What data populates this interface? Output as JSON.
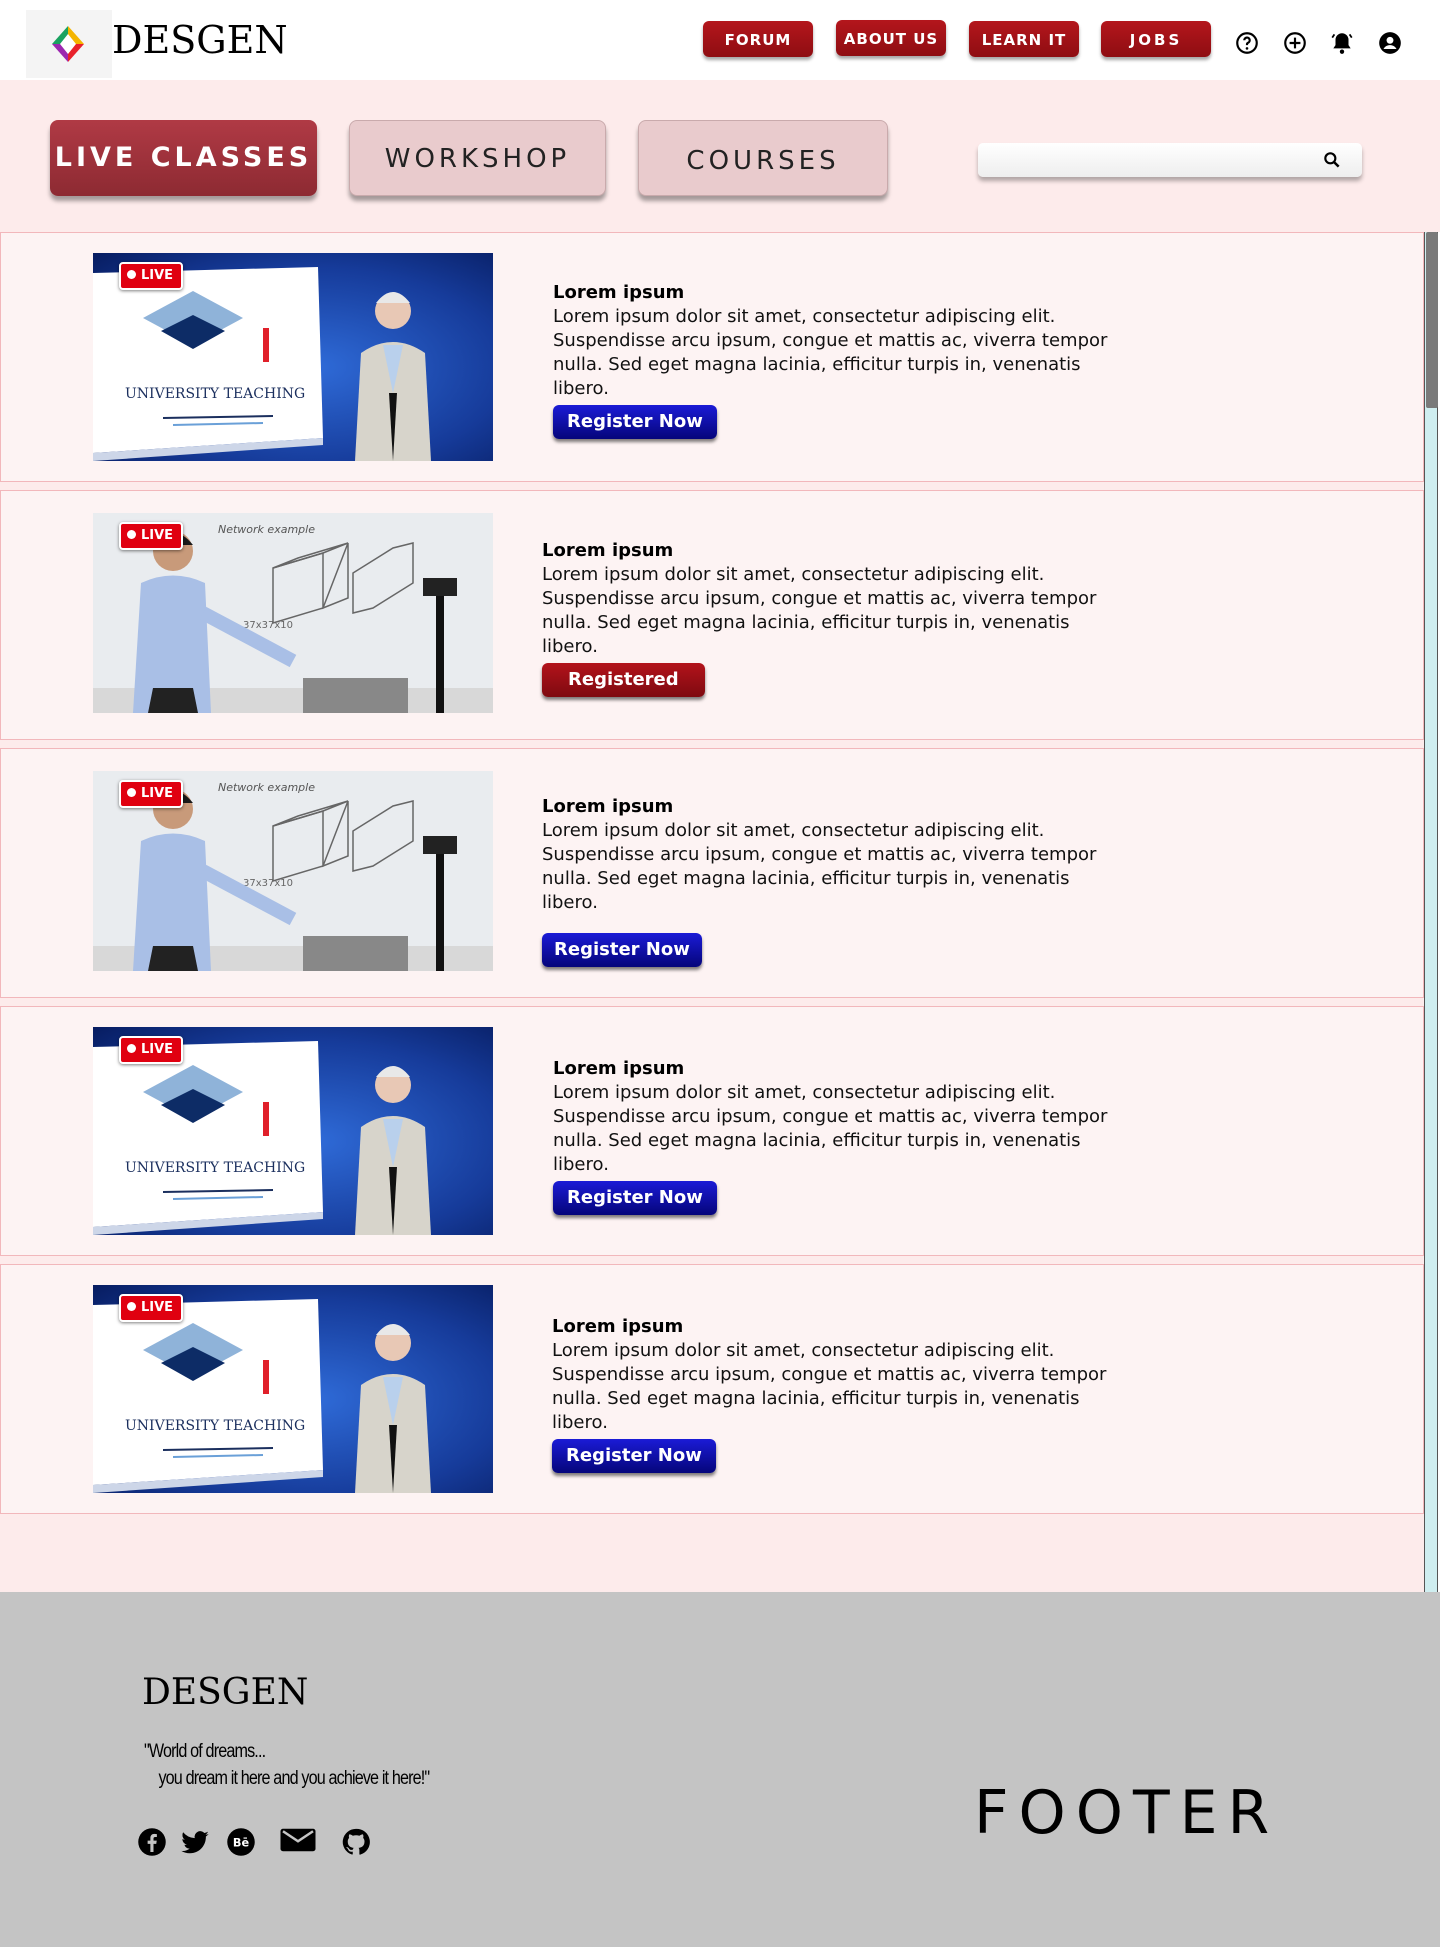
{
  "header": {
    "brand": "DESGEN",
    "nav": [
      {
        "label": "FORUM"
      },
      {
        "label": "ABOUT US"
      },
      {
        "label": "LEARN IT"
      },
      {
        "label": "JOBS"
      }
    ],
    "icons": [
      "help-icon",
      "add-circle-icon",
      "bell-icon",
      "account-icon"
    ]
  },
  "tabs": [
    {
      "label": "LIVE CLASSES",
      "active": true
    },
    {
      "label": "WORKSHOP",
      "active": false
    },
    {
      "label": "COURSES",
      "active": false
    }
  ],
  "search": {
    "placeholder": "",
    "value": ""
  },
  "classes": [
    {
      "badge": "LIVE",
      "thumbnail": "university-teaching-video",
      "title": "Lorem ipsum",
      "description": "Lorem ipsum dolor sit amet, consectetur adipiscing elit. Suspendisse arcu ipsum, congue et mattis ac, viverra tempor nulla. Sed eget magna lacinia, efficitur turpis in, venenatis libero.",
      "button": "Register Now",
      "status": "register"
    },
    {
      "badge": "LIVE",
      "thumbnail": "whiteboard-lecture-video",
      "title": "Lorem ipsum",
      "description": "Lorem ipsum dolor sit amet, consectetur adipiscing elit. Suspendisse arcu ipsum, congue et mattis ac, viverra tempor nulla. Sed eget magna lacinia, efficitur turpis in, venenatis libero.",
      "button": "Registered",
      "status": "registered"
    },
    {
      "badge": "LIVE",
      "thumbnail": "whiteboard-lecture-video",
      "title": "Lorem ipsum",
      "description": "Lorem ipsum dolor sit amet, consectetur adipiscing elit. Suspendisse arcu ipsum, congue et mattis ac, viverra tempor nulla. Sed eget magna lacinia, efficitur turpis in, venenatis libero.",
      "button": "Register Now",
      "status": "register"
    },
    {
      "badge": "LIVE",
      "thumbnail": "university-teaching-video",
      "title": "Lorem ipsum",
      "description": "Lorem ipsum dolor sit amet, consectetur adipiscing elit. Suspendisse arcu ipsum, congue et mattis ac, viverra tempor nulla. Sed eget magna lacinia, efficitur turpis in, venenatis libero.",
      "button": "Register Now",
      "status": "register"
    },
    {
      "badge": "LIVE",
      "thumbnail": "university-teaching-video",
      "title": "Lorem ipsum",
      "description": "Lorem ipsum dolor sit amet, consectetur adipiscing elit. Suspendisse arcu ipsum, congue et mattis ac, viverra tempor nulla. Sed eget magna lacinia, efficitur turpis in, venenatis libero.",
      "button": "Register Now",
      "status": "register"
    }
  ],
  "thumb_text": {
    "university": "UNIVERSITY TEACHING",
    "whiteboard": "Network example"
  },
  "footer": {
    "brand": "DESGEN",
    "quote_line1": "\"World of dreams...",
    "quote_line2": "you dream it here and you achieve it here!\"",
    "label": "FOOTER",
    "social": [
      "facebook-icon",
      "twitter-icon",
      "behance-icon",
      "mail-icon",
      "github-icon"
    ]
  },
  "colors": {
    "nav_red": "#a0141a",
    "tab_active": "#a0353e",
    "tab_inactive": "#e9cbcd",
    "register_blue": "#0c0cb0",
    "registered_red": "#9a1016",
    "page_pink": "#fdebeb",
    "footer_gray": "#c4c4c4"
  }
}
